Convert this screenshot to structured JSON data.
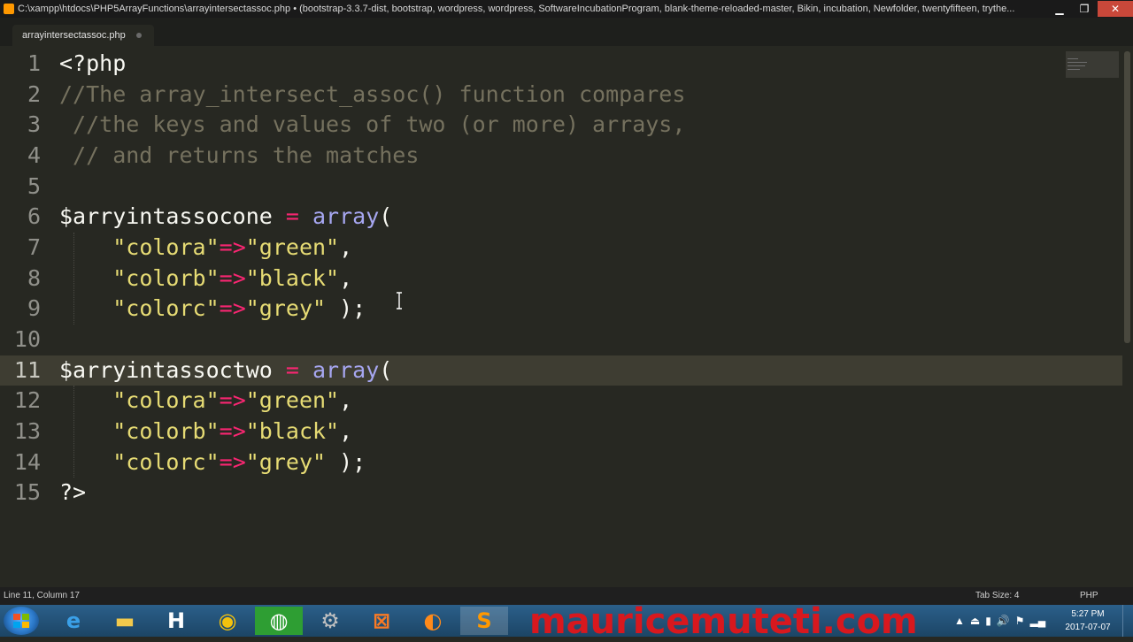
{
  "window": {
    "title": "C:\\xampp\\htdocs\\PHP5ArrayFunctions\\arrayintersectassoc.php • (bootstrap-3.3.7-dist, bootstrap, wordpress, wordpress, SoftwareIncubationProgram, blank-theme-reloaded-master, Bikin, incubation, Newfolder, twentyfifteen, trythe..."
  },
  "tabs": [
    {
      "label": "arrayintersectassoc.php"
    }
  ],
  "editor": {
    "current_line": 11,
    "lines": [
      {
        "num": "1",
        "tokens": [
          {
            "t": "<?php",
            "c": "tag"
          }
        ]
      },
      {
        "num": "2",
        "tokens": [
          {
            "t": "//The array_intersect_assoc() function compares",
            "c": "comment"
          }
        ]
      },
      {
        "num": "3",
        "tokens": [
          {
            "t": " //the keys and values of two (or more) arrays,",
            "c": "comment"
          }
        ]
      },
      {
        "num": "4",
        "tokens": [
          {
            "t": " // and returns the matches",
            "c": "comment"
          }
        ]
      },
      {
        "num": "5",
        "tokens": []
      },
      {
        "num": "6",
        "tokens": [
          {
            "t": "$arryintassocone",
            "c": "var"
          },
          {
            "t": " = ",
            "c": "op"
          },
          {
            "t": "array",
            "c": "fn"
          },
          {
            "t": "(",
            "c": "plain"
          }
        ]
      },
      {
        "num": "7",
        "tokens": [
          {
            "t": "    ",
            "c": "plain"
          },
          {
            "t": "\"colora\"",
            "c": "str"
          },
          {
            "t": "=>",
            "c": "op"
          },
          {
            "t": "\"green\"",
            "c": "str"
          },
          {
            "t": ",",
            "c": "plain"
          }
        ]
      },
      {
        "num": "8",
        "tokens": [
          {
            "t": "    ",
            "c": "plain"
          },
          {
            "t": "\"colorb\"",
            "c": "str"
          },
          {
            "t": "=>",
            "c": "op"
          },
          {
            "t": "\"black\"",
            "c": "str"
          },
          {
            "t": ",",
            "c": "plain"
          }
        ]
      },
      {
        "num": "9",
        "tokens": [
          {
            "t": "    ",
            "c": "plain"
          },
          {
            "t": "\"colorc\"",
            "c": "str"
          },
          {
            "t": "=>",
            "c": "op"
          },
          {
            "t": "\"grey\"",
            "c": "str"
          },
          {
            "t": " );",
            "c": "plain"
          }
        ]
      },
      {
        "num": "10",
        "tokens": []
      },
      {
        "num": "11",
        "tokens": [
          {
            "t": "$arryintassoctwo",
            "c": "var"
          },
          {
            "t": " = ",
            "c": "op"
          },
          {
            "t": "array",
            "c": "fn"
          },
          {
            "t": "(",
            "c": "plain"
          }
        ]
      },
      {
        "num": "12",
        "tokens": [
          {
            "t": "    ",
            "c": "plain"
          },
          {
            "t": "\"colora\"",
            "c": "str"
          },
          {
            "t": "=>",
            "c": "op"
          },
          {
            "t": "\"green\"",
            "c": "str"
          },
          {
            "t": ",",
            "c": "plain"
          }
        ]
      },
      {
        "num": "13",
        "tokens": [
          {
            "t": "    ",
            "c": "plain"
          },
          {
            "t": "\"colorb\"",
            "c": "str"
          },
          {
            "t": "=>",
            "c": "op"
          },
          {
            "t": "\"black\"",
            "c": "str"
          },
          {
            "t": ",",
            "c": "plain"
          }
        ]
      },
      {
        "num": "14",
        "tokens": [
          {
            "t": "    ",
            "c": "plain"
          },
          {
            "t": "\"colorc\"",
            "c": "str"
          },
          {
            "t": "=>",
            "c": "op"
          },
          {
            "t": "\"grey\"",
            "c": "str"
          },
          {
            "t": " );",
            "c": "plain"
          }
        ]
      },
      {
        "num": "15",
        "tokens": [
          {
            "t": "?>",
            "c": "tag"
          }
        ]
      }
    ]
  },
  "status": {
    "position": "Line 11, Column 17",
    "tab_size": "Tab Size: 4",
    "syntax": "PHP"
  },
  "taskbar": {
    "apps": [
      {
        "name": "internet-explorer-icon",
        "glyph": "e",
        "color": "#3aa0e8"
      },
      {
        "name": "file-explorer-icon",
        "glyph": "▬",
        "color": "#f2c94c"
      },
      {
        "name": "h-app-icon",
        "glyph": "H",
        "color": "#ffffff"
      },
      {
        "name": "chrome-icon",
        "glyph": "◉",
        "color": "#f4c20d"
      },
      {
        "name": "globe-app-icon",
        "glyph": "◍",
        "color": "#ffffff"
      },
      {
        "name": "tools-icon",
        "glyph": "⚙",
        "color": "#c0c0c0"
      },
      {
        "name": "xampp-icon",
        "glyph": "⊠",
        "color": "#fb7a24"
      },
      {
        "name": "firefox-icon",
        "glyph": "◐",
        "color": "#ff8a1a"
      },
      {
        "name": "sublime-text-icon",
        "glyph": "S",
        "color": "#ff9800"
      }
    ],
    "watermark": "mauricemuteti.com",
    "clock_time": "5:27 PM",
    "clock_date": "2017-07-07"
  }
}
